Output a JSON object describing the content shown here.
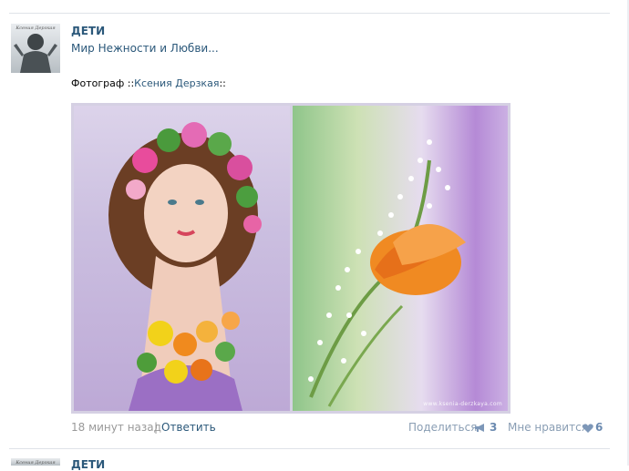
{
  "post": {
    "author": "ДЕТИ",
    "avatar_caption": "Ксения Дерзкая",
    "text": "Мир Нежности и Любви...",
    "credit_prefix": "Фотограф ::",
    "credit_name": "Ксения Дерзкая",
    "credit_suffix": "::",
    "photo_watermark": "www.ksenia-derzkaya.com",
    "time": "18 минут назад",
    "separator": "|",
    "reply_label": "Ответить",
    "share_label": "Поделиться",
    "share_icon": "megaphone-icon",
    "share_count": "3",
    "like_label": "Мне нравится",
    "like_icon": "heart-icon",
    "like_count": "6"
  },
  "next_post": {
    "author": "ДЕТИ"
  },
  "colors": {
    "link": "#2b587a",
    "muted": "#999999",
    "action": "#8a9eb4",
    "count": "#6b8ab0"
  }
}
